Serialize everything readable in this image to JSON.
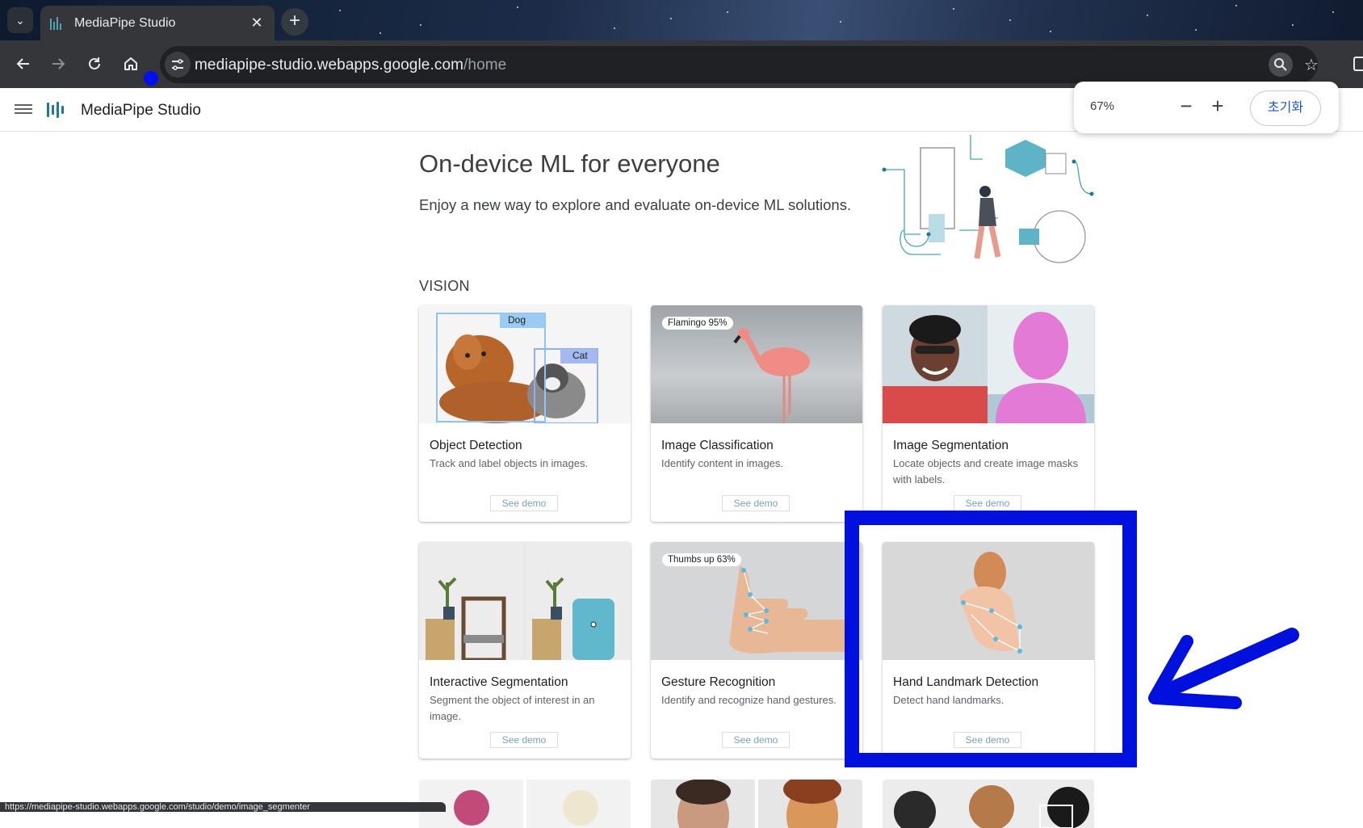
{
  "browser": {
    "tab_title": "MediaPipe Studio",
    "url_host": "mediapipe-studio.webapps.google.com",
    "url_path": "/home",
    "status_url": "https://mediapipe-studio.webapps.google.com/studio/demo/image_segmenter"
  },
  "zoom": {
    "level": "67%",
    "reset_label": "초기화"
  },
  "app": {
    "title": "MediaPipe Studio"
  },
  "hero": {
    "title": "On-device ML for everyone",
    "subtitle": "Enjoy a new way to explore and evaluate on-device ML solutions."
  },
  "section": {
    "label": "VISION"
  },
  "cards": [
    {
      "title": "Object Detection",
      "desc": "Track and label objects in images.",
      "demo": "See demo",
      "labels": [
        "Dog",
        "Cat"
      ]
    },
    {
      "title": "Image Classification",
      "desc": "Identify content in images.",
      "demo": "See demo",
      "badge": "Flamingo 95%"
    },
    {
      "title": "Image Segmentation",
      "desc": "Locate objects and create image masks with labels.",
      "demo": "See demo"
    },
    {
      "title": "Interactive Segmentation",
      "desc": "Segment the object of interest in an image.",
      "demo": "See demo"
    },
    {
      "title": "Gesture Recognition",
      "desc": "Identify and recognize hand gestures.",
      "demo": "See demo",
      "badge": "Thumbs up 63%"
    },
    {
      "title": "Hand Landmark Detection",
      "desc": "Detect hand landmarks.",
      "demo": "See demo"
    }
  ],
  "colors": {
    "highlight": "#0011dd",
    "accent": "#1f7a90"
  }
}
